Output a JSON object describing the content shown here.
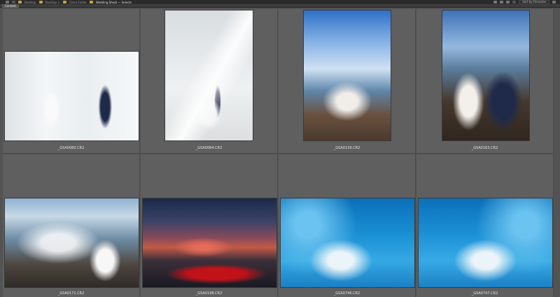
{
  "path": {
    "crumbs": [
      "Desktop",
      "Desktop >",
      "Client Folder",
      "Wedding Shoot — Selects"
    ],
    "active": "Wedding Shoot — Selects"
  },
  "toolbar": {
    "sort_label": "Sort by Filename"
  },
  "tab": {
    "label": "Content"
  },
  "thumbnails": [
    {
      "filename": "_GSA0080.CR2"
    },
    {
      "filename": "_GSA0084.CR2"
    },
    {
      "filename": "_GSA0139.CR2"
    },
    {
      "filename": "_GSA0163.CR2"
    },
    {
      "filename": "_GSA0171.CR2"
    },
    {
      "filename": "_GSA0198.CR2"
    },
    {
      "filename": "_GSA0746.CR2"
    },
    {
      "filename": "_GSA0747.CR2"
    }
  ],
  "colors": {
    "background": "#535353",
    "cell": "#5f5f5f",
    "folder": "#c8a43a"
  }
}
